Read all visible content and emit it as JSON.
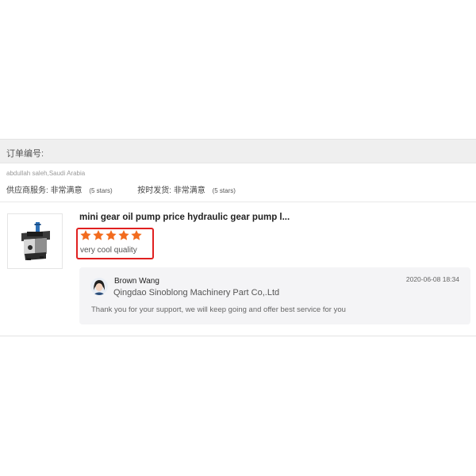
{
  "order": {
    "label": "订单编号:"
  },
  "buyer": {
    "info": "abdullah saleh,Saudi Arabia"
  },
  "ratings": {
    "supplier_service_label": "供应商服务:",
    "supplier_service_value": "非常满意",
    "supplier_service_stars": "(5 stars)",
    "on_time_delivery_label": "按时发货:",
    "on_time_delivery_value": "非常满意",
    "on_time_delivery_stars": "(5 stars)"
  },
  "product": {
    "title": "mini gear oil pump price hydraulic gear pump l...",
    "thumbnail_icon": "gear-pump-image"
  },
  "review": {
    "rating": 5,
    "max_rating": 5,
    "star_color": "#f26b1d",
    "text": "very cool quality"
  },
  "reply": {
    "name": "Brown Wang",
    "company": "Qingdao Sinoblong Machinery Part Co,.Ltd",
    "date": "2020-06-08 18:34",
    "text": "Thank you for your support, we will keep going and offer best service for you"
  },
  "colors": {
    "header_bg": "#efefef",
    "highlight_border": "#e02020",
    "reply_bg": "#f4f4f6"
  }
}
